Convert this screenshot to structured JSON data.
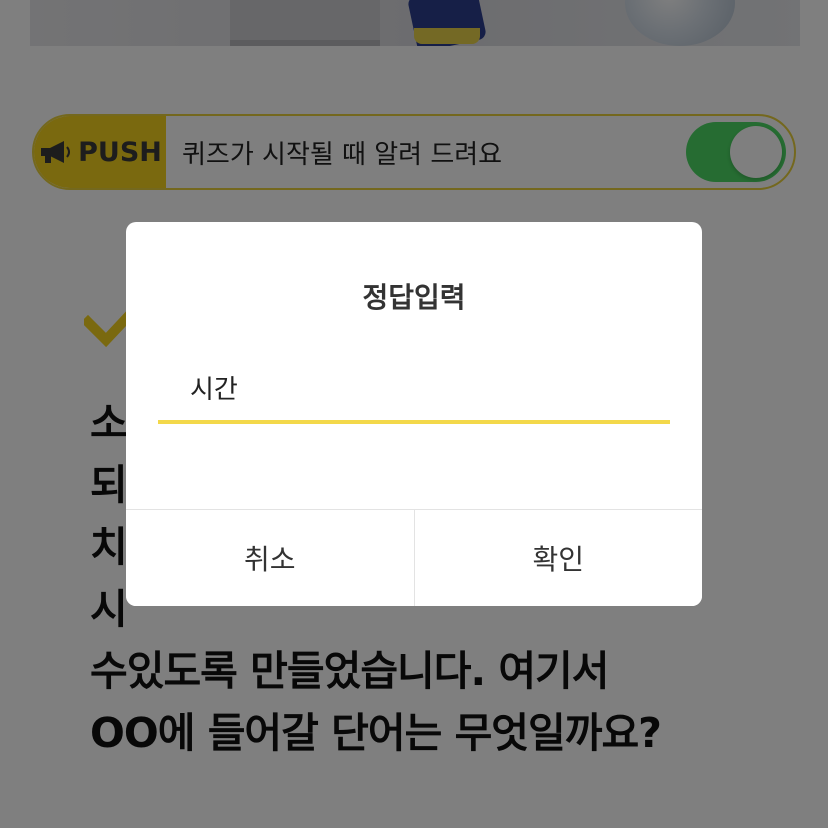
{
  "push_banner": {
    "badge_label": "PUSH",
    "message": "퀴즈가 시작될 때 알려 드려요",
    "toggle_on": true
  },
  "quiz": {
    "question": "소\n되\n치\n시\n수있도록 만들었습니다. 여기서\nOO에 들어갈 단어는 무엇일까요?"
  },
  "dialog": {
    "title": "정답입력",
    "input_value": "시간",
    "cancel_label": "취소",
    "confirm_label": "확인"
  },
  "colors": {
    "accent_yellow": "#f5d21e",
    "toggle_green": "#4cd964",
    "input_underline": "#f3d84a"
  }
}
